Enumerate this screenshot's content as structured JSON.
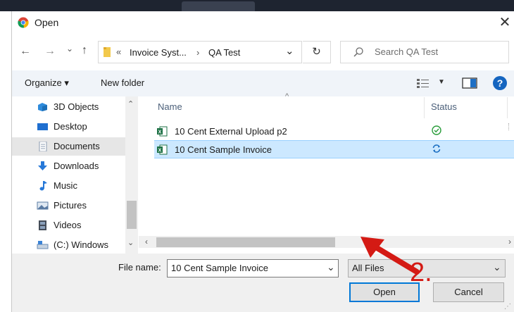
{
  "window": {
    "title": "Open",
    "close_glyph": "✕"
  },
  "nav": {
    "back": "←",
    "forward": "→",
    "recent": "⌄",
    "up": "↑"
  },
  "address": {
    "overflow": "«",
    "crumbs": [
      "Invoice Syst...",
      "QA Test"
    ],
    "separator": "›",
    "dropdown": "⌄",
    "refresh": "↻"
  },
  "search": {
    "placeholder": "Search QA Test"
  },
  "toolbar": {
    "organize": "Organize ▾",
    "new_folder": "New folder",
    "help": "?"
  },
  "sidebar": {
    "items": [
      {
        "label": "3D Objects",
        "icon": "cube-icon",
        "color": "#2e8bdc"
      },
      {
        "label": "Desktop",
        "icon": "desktop-icon",
        "color": "#1f6fd0"
      },
      {
        "label": "Documents",
        "icon": "document-icon",
        "color": "#8b9bb0"
      },
      {
        "label": "Downloads",
        "icon": "download-icon",
        "color": "#2678d8"
      },
      {
        "label": "Music",
        "icon": "music-icon",
        "color": "#2678d8"
      },
      {
        "label": "Pictures",
        "icon": "pictures-icon",
        "color": "#5a7ba3"
      },
      {
        "label": "Videos",
        "icon": "videos-icon",
        "color": "#444c58"
      },
      {
        "label": "(C:) Windows",
        "icon": "drive-icon",
        "color": "#6a8bb5"
      }
    ],
    "selected": "Documents"
  },
  "file_list": {
    "columns": {
      "name": "Name",
      "status": "Status"
    },
    "files": [
      {
        "name": "10 Cent External Upload p2",
        "status": "synced",
        "status_glyph": "⊘",
        "status_color": "#2a9d3b"
      },
      {
        "name": "10 Cent Sample Invoice",
        "status": "syncing",
        "status_glyph": "⟳",
        "status_color": "#1b6ec2"
      }
    ],
    "selected": "10 Cent Sample Invoice"
  },
  "footer": {
    "file_name_label": "File name:",
    "file_name_value": "10 Cent Sample Invoice",
    "filter": "All Files",
    "open": "Open",
    "cancel": "Cancel"
  },
  "annotation": {
    "step": "2.",
    "color": "#d41a14"
  },
  "colors": {
    "accent": "#0078d7",
    "selection": "#cce8ff",
    "excel": "#1d7145"
  }
}
